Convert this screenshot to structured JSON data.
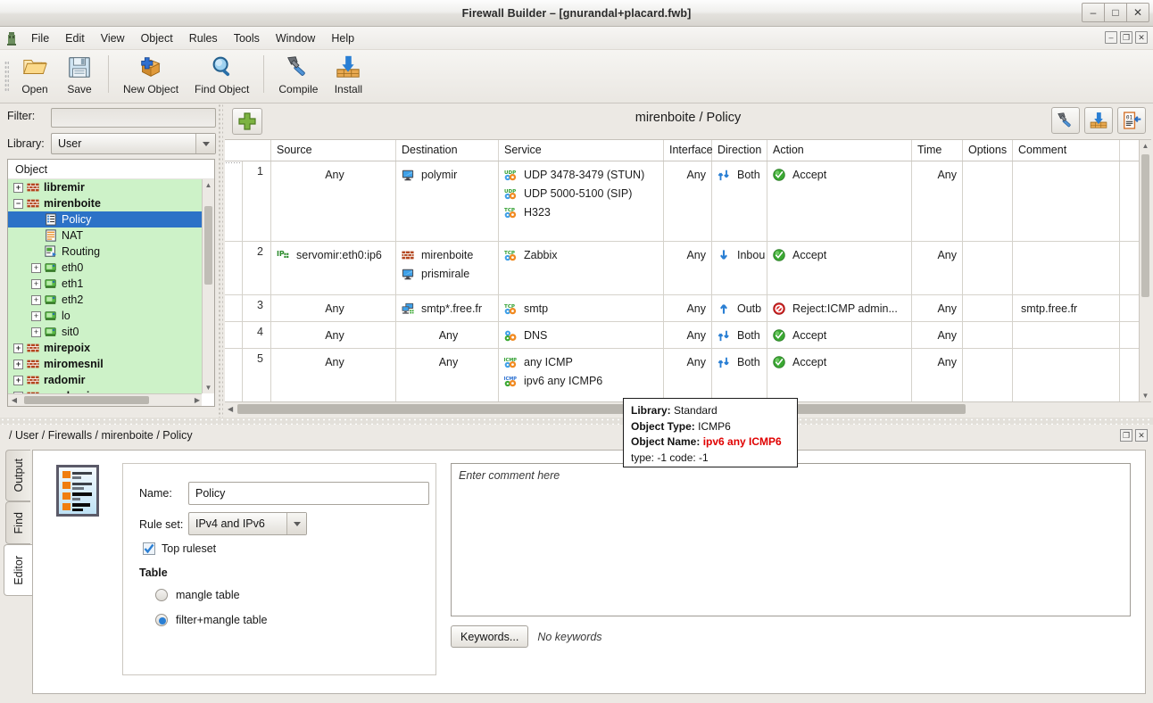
{
  "window": {
    "title": "Firewall Builder  – [gnurandal+placard.fwb]",
    "minimize": "–",
    "maximize": "□",
    "close": "✕"
  },
  "mdi_buttons": {
    "minimize": "–",
    "restore": "❐",
    "close": "✕"
  },
  "menubar": {
    "items": [
      {
        "label": "File"
      },
      {
        "label": "Edit"
      },
      {
        "label": "View"
      },
      {
        "label": "Object"
      },
      {
        "label": "Rules"
      },
      {
        "label": "Tools"
      },
      {
        "label": "Window"
      },
      {
        "label": "Help"
      }
    ]
  },
  "toolbar": {
    "items": [
      {
        "label": "Open",
        "icon": "open-folder-icon"
      },
      {
        "label": "Save",
        "icon": "floppy-disk-icon"
      },
      {
        "label": "New Object",
        "icon": "new-object-icon"
      },
      {
        "label": "Find Object",
        "icon": "magnifier-icon"
      },
      {
        "label": "Compile",
        "icon": "hammer-icon"
      },
      {
        "label": "Install",
        "icon": "install-icon"
      }
    ]
  },
  "sidebar": {
    "filter_label": "Filter:",
    "filter_value": "",
    "filter_placeholder": "",
    "library_label": "Library:",
    "library_value": "User",
    "tree_header": "Object",
    "tree": [
      {
        "label": "libremir",
        "indent": 1,
        "expander": "+",
        "icon": "firewall-icon",
        "bold": true,
        "selected": false
      },
      {
        "label": "mirenboite",
        "indent": 1,
        "expander": "−",
        "icon": "firewall-icon",
        "bold": true,
        "selected": false
      },
      {
        "label": "Policy",
        "indent": 2,
        "expander": "",
        "icon": "policy-icon",
        "bold": false,
        "selected": true
      },
      {
        "label": "NAT",
        "indent": 2,
        "expander": "",
        "icon": "nat-icon",
        "bold": false,
        "selected": false
      },
      {
        "label": "Routing",
        "indent": 2,
        "expander": "",
        "icon": "routing-icon",
        "bold": false,
        "selected": false
      },
      {
        "label": "eth0",
        "indent": 2,
        "expander": "+",
        "icon": "interface-icon",
        "bold": false,
        "selected": false
      },
      {
        "label": "eth1",
        "indent": 2,
        "expander": "+",
        "icon": "interface-icon",
        "bold": false,
        "selected": false
      },
      {
        "label": "eth2",
        "indent": 2,
        "expander": "+",
        "icon": "interface-icon",
        "bold": false,
        "selected": false
      },
      {
        "label": "lo",
        "indent": 2,
        "expander": "+",
        "icon": "interface-icon",
        "bold": false,
        "selected": false
      },
      {
        "label": "sit0",
        "indent": 2,
        "expander": "+",
        "icon": "interface-icon",
        "bold": false,
        "selected": false
      },
      {
        "label": "mirepoix",
        "indent": 1,
        "expander": "+",
        "icon": "firewall-icon",
        "bold": true,
        "selected": false
      },
      {
        "label": "miromesnil",
        "indent": 1,
        "expander": "+",
        "icon": "firewall-icon",
        "bold": true,
        "selected": false
      },
      {
        "label": "radomir",
        "indent": 1,
        "expander": "+",
        "icon": "firewall-icon",
        "bold": true,
        "selected": false
      },
      {
        "label": "sandomir",
        "indent": 1,
        "expander": "+",
        "icon": "firewall-icon",
        "bold": true,
        "selected": false
      }
    ]
  },
  "rules": {
    "title": "mirenboite / Policy",
    "add_button_icon": "green-plus-icon",
    "right_tools": [
      {
        "name": "compile-rules-button",
        "icon": "hammer-icon"
      },
      {
        "name": "install-rules-button",
        "icon": "install-icon"
      },
      {
        "name": "compiled-output-button",
        "icon": "compiled-doc-icon"
      }
    ],
    "columns": [
      "",
      "Source",
      "Destination",
      "Service",
      "Interface",
      "Direction",
      "Action",
      "Time",
      "Options",
      "Comment"
    ],
    "rows": [
      {
        "num": "1",
        "source": [
          {
            "text": "Any",
            "icon": "none"
          }
        ],
        "destination": [
          {
            "text": "polymir",
            "icon": "host-icon"
          }
        ],
        "service": [
          {
            "text": "UDP 3478-3479 (STUN)",
            "icon": "udp-service-icon"
          },
          {
            "text": "UDP 5000-5100 (SIP)",
            "icon": "udp-service-icon"
          },
          {
            "text": "H323",
            "icon": "tcp-service-icon"
          }
        ],
        "interface": "Any",
        "direction": "Both",
        "direction_icon": "both-arrows-icon",
        "action": "Accept",
        "action_icon": "accept-icon",
        "time": "Any",
        "options": "",
        "comment": ""
      },
      {
        "num": "2",
        "source": [
          {
            "text": "servomir:eth0:ip6",
            "icon": "address-icon"
          }
        ],
        "destination": [
          {
            "text": "mirenboite",
            "icon": "firewall-icon"
          },
          {
            "text": "prismirale",
            "icon": "host-icon"
          }
        ],
        "service": [
          {
            "text": "Zabbix",
            "icon": "tcp-service-icon"
          }
        ],
        "interface": "Any",
        "direction": "Inbou",
        "direction_icon": "inbound-arrow-icon",
        "action": "Accept",
        "action_icon": "accept-icon",
        "time": "Any",
        "options": "",
        "comment": ""
      },
      {
        "num": "3",
        "source": [
          {
            "text": "Any",
            "icon": "none"
          }
        ],
        "destination": [
          {
            "text": "smtp*.free.fr",
            "icon": "hostgroup-icon"
          }
        ],
        "service": [
          {
            "text": "smtp",
            "icon": "tcp-service-icon"
          }
        ],
        "interface": "Any",
        "direction": "Outb",
        "direction_icon": "outbound-arrow-icon",
        "action": "Reject:ICMP admin...",
        "action_icon": "reject-icon",
        "time": "Any",
        "options": "",
        "comment": "smtp.free.fr"
      },
      {
        "num": "4",
        "source": [
          {
            "text": "Any",
            "icon": "none"
          }
        ],
        "destination": [
          {
            "text": "Any",
            "icon": "none"
          }
        ],
        "service": [
          {
            "text": "DNS",
            "icon": "group-service-icon"
          }
        ],
        "interface": "Any",
        "direction": "Both",
        "direction_icon": "both-arrows-icon",
        "action": "Accept",
        "action_icon": "accept-icon",
        "time": "Any",
        "options": "",
        "comment": ""
      },
      {
        "num": "5",
        "source": [
          {
            "text": "Any",
            "icon": "none"
          }
        ],
        "destination": [
          {
            "text": "Any",
            "icon": "none"
          }
        ],
        "service": [
          {
            "text": "any ICMP",
            "icon": "icmp-service-icon"
          },
          {
            "text": "ipv6 any ICMP6",
            "icon": "icmp6-service-icon"
          }
        ],
        "interface": "Any",
        "direction": "Both",
        "direction_icon": "both-arrows-icon",
        "action": "Accept",
        "action_icon": "accept-icon",
        "time": "Any",
        "options": "",
        "comment": ""
      }
    ]
  },
  "tooltip": {
    "library_label": "Library:",
    "library_value": "Standard",
    "type_label": "Object Type:",
    "type_value": "ICMP6",
    "name_label": "Object Name:",
    "name_value": "ipv6 any ICMP6",
    "detail": "type: -1 code: -1"
  },
  "bottom": {
    "breadcrumb": "/ User / Firewalls / mirenboite / Policy",
    "panel_buttons": [
      {
        "name": "float-panel-button",
        "glyph": "❐"
      },
      {
        "name": "close-panel-button",
        "glyph": "✕"
      }
    ],
    "tabs": [
      {
        "label": "Output",
        "active": false
      },
      {
        "label": "Find",
        "active": false
      },
      {
        "label": "Editor",
        "active": true
      }
    ],
    "editor": {
      "object_icon": "ruleset-icon",
      "name_label": "Name:",
      "name_value": "Policy",
      "ruleset_label": "Rule set:",
      "ruleset_value": "IPv4 and IPv6",
      "top_ruleset_label": "Top ruleset",
      "top_ruleset_checked": true,
      "table_group_label": "Table",
      "table_options": [
        {
          "label": "mangle table",
          "selected": false
        },
        {
          "label": "filter+mangle table",
          "selected": true
        }
      ],
      "comment_placeholder": "Enter comment here",
      "keywords_button": "Keywords...",
      "keywords_text": "No keywords"
    }
  },
  "colors": {
    "tree_bg": "#cdf2c8",
    "selection": "#2c72c7",
    "accept": "#34a832",
    "reject": "#d41f1f",
    "tooltip_accent": "#e00000",
    "chrome": "#ece9e4"
  }
}
